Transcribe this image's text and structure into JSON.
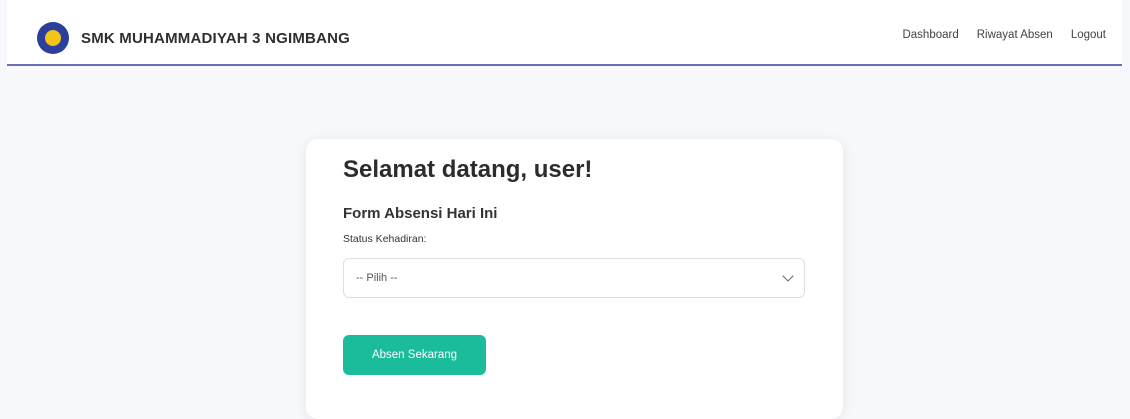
{
  "header": {
    "brand_name": "SMK MUHAMMADIYAH 3 NGIMBANG",
    "logo_icon": "school-emblem-icon",
    "nav": [
      {
        "label": "Dashboard"
      },
      {
        "label": "Riwayat Absen"
      },
      {
        "label": "Logout"
      }
    ],
    "accent_color": "#6b6fb8"
  },
  "card": {
    "welcome": "Selamat datang, user!",
    "form_title": "Form Absensi Hari Ini",
    "status_label": "Status Kehadiran:",
    "status_select": {
      "selected": "-- Pilih --",
      "icon": "chevron-down-icon"
    },
    "submit_label": "Absen Sekarang",
    "button_color": "#1abc9c"
  }
}
